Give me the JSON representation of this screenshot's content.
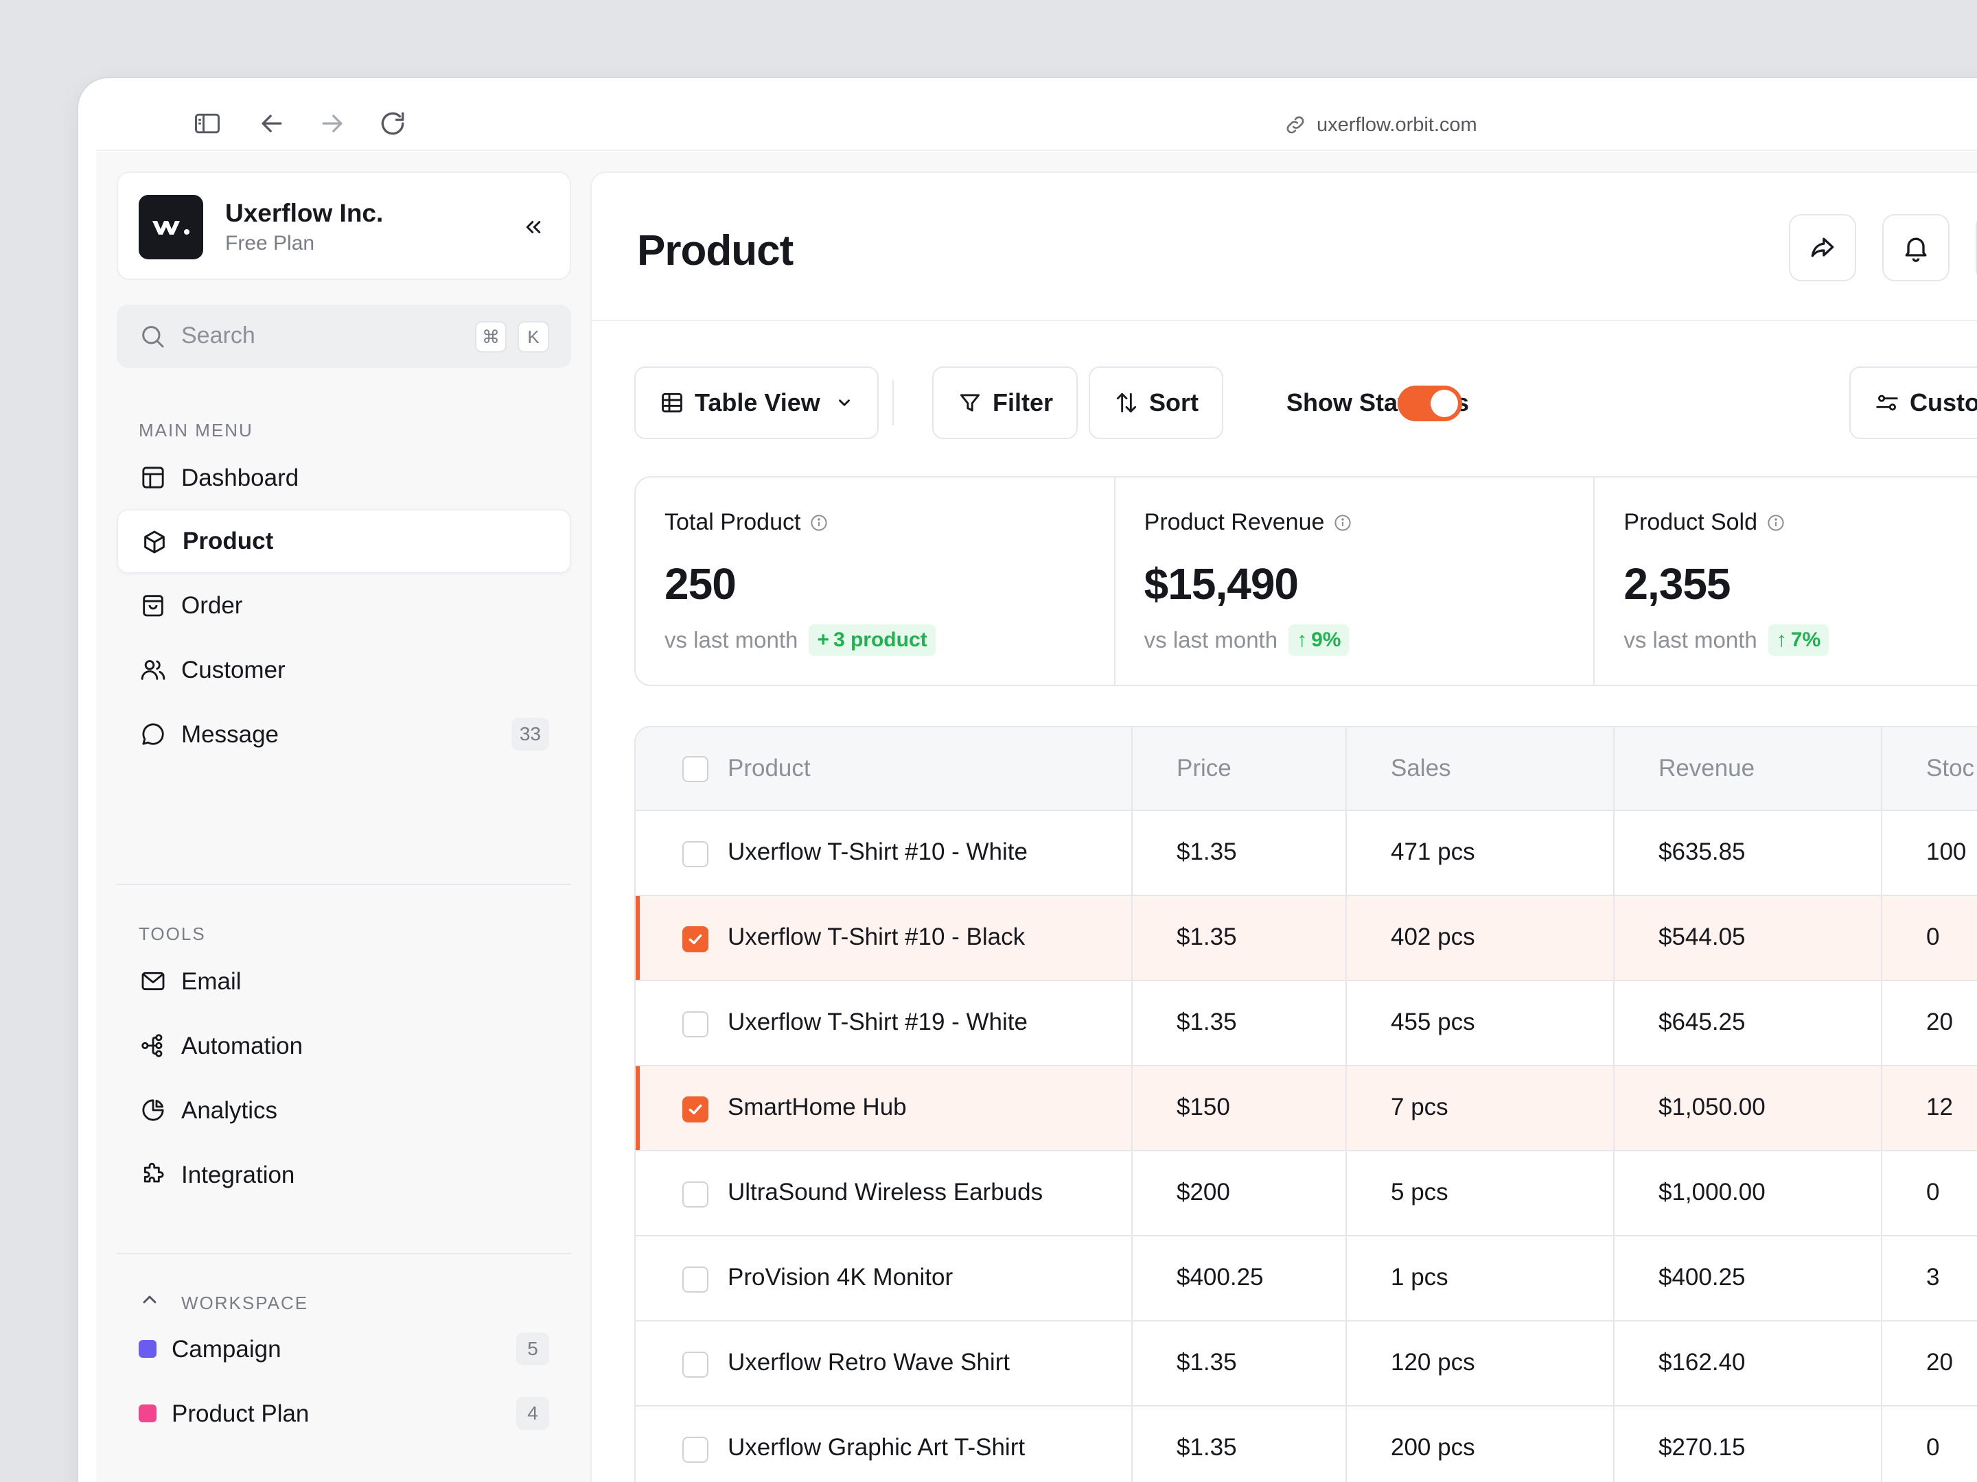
{
  "browser": {
    "url": "uxerflow.orbit.com"
  },
  "sidebar": {
    "company": {
      "name": "Uxerflow Inc.",
      "plan": "Free Plan"
    },
    "search": {
      "placeholder": "Search",
      "shortcut_mod": "⌘",
      "shortcut_key": "K"
    },
    "main_menu_label": "MAIN MENU",
    "main_menu": [
      {
        "label": "Dashboard",
        "icon": "layout-icon"
      },
      {
        "label": "Product",
        "icon": "box-icon",
        "active": true
      },
      {
        "label": "Order",
        "icon": "shopping-bag-icon"
      },
      {
        "label": "Customer",
        "icon": "users-icon"
      },
      {
        "label": "Message",
        "icon": "chat-icon",
        "count": "33"
      }
    ],
    "tools_label": "TOOLS",
    "tools": [
      {
        "label": "Email",
        "icon": "mail-icon"
      },
      {
        "label": "Automation",
        "icon": "flow-icon"
      },
      {
        "label": "Analytics",
        "icon": "pie-chart-icon"
      },
      {
        "label": "Integration",
        "icon": "puzzle-icon"
      }
    ],
    "workspace_label": "WORKSPACE",
    "workspace": [
      {
        "label": "Campaign",
        "color": "#6a5cf0",
        "count": "5"
      },
      {
        "label": "Product Plan",
        "color": "#f2458e",
        "count": "4"
      }
    ]
  },
  "main": {
    "title": "Product",
    "toolbar": {
      "view": "Table View",
      "filter": "Filter",
      "sort": "Sort",
      "stats_toggle": "Show Statistics",
      "stats_on": true,
      "customize": "Custor"
    },
    "stats": [
      {
        "label": "Total Product",
        "value": "250",
        "compare": "vs last month",
        "delta": "3 product",
        "delta_sign": "+"
      },
      {
        "label": "Product Revenue",
        "value": "$15,490",
        "compare": "vs last month",
        "delta": "9%",
        "delta_sign": "↑"
      },
      {
        "label": "Product Sold",
        "value": "2,355",
        "compare": "vs last month",
        "delta": "7%",
        "delta_sign": "↑"
      }
    ],
    "table": {
      "headers": [
        "Product",
        "Price",
        "Sales",
        "Revenue",
        "Stock"
      ],
      "header_visible_text": [
        "Product",
        "Price",
        "Sales",
        "Revenue",
        "Stoc"
      ],
      "rows": [
        {
          "product": "Uxerflow T-Shirt #10 - White",
          "price": "$1.35",
          "sales": "471 pcs",
          "revenue": "$635.85",
          "stock": "100",
          "selected": false
        },
        {
          "product": "Uxerflow T-Shirt #10 - Black",
          "price": "$1.35",
          "sales": "402 pcs",
          "revenue": "$544.05",
          "stock": "0",
          "selected": true
        },
        {
          "product": "Uxerflow T-Shirt #19 - White",
          "price": "$1.35",
          "sales": "455 pcs",
          "revenue": "$645.25",
          "stock": "20",
          "selected": false
        },
        {
          "product": "SmartHome Hub",
          "price": "$150",
          "sales": "7 pcs",
          "revenue": "$1,050.00",
          "stock": "12",
          "selected": true
        },
        {
          "product": "UltraSound Wireless Earbuds",
          "price": "$200",
          "sales": "5 pcs",
          "revenue": "$1,000.00",
          "stock": "0",
          "selected": false
        },
        {
          "product": "ProVision 4K Monitor",
          "price": "$400.25",
          "sales": "1 pcs",
          "revenue": "$400.25",
          "stock": "3",
          "selected": false
        },
        {
          "product": "Uxerflow Retro Wave Shirt",
          "price": "$1.35",
          "sales": "120 pcs",
          "revenue": "$162.40",
          "stock": "20",
          "selected": false
        },
        {
          "product": "Uxerflow Graphic Art T-Shirt",
          "price": "$1.35",
          "sales": "200 pcs",
          "revenue": "$270.15",
          "stock": "0",
          "selected": false
        }
      ]
    }
  },
  "colors": {
    "accent": "#f2622e",
    "success": "#1fb24f",
    "success_bg": "#e7f8ec",
    "selected_row_bg": "#fff3f0"
  }
}
